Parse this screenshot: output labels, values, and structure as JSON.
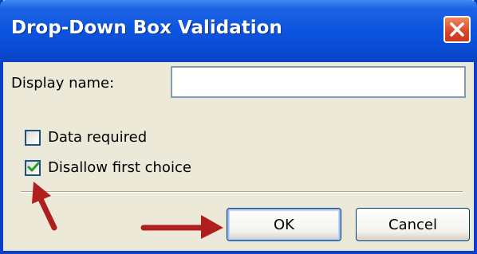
{
  "dialog": {
    "title": "Drop-Down Box Validation",
    "close_icon": "close-icon",
    "display_name": {
      "label": "Display name:",
      "value": ""
    },
    "checkboxes": [
      {
        "label": "Data required",
        "checked": false
      },
      {
        "label": "Disallow first choice",
        "checked": true
      }
    ],
    "buttons": {
      "ok": "OK",
      "cancel": "Cancel"
    },
    "annotations": [
      {
        "icon": "red-arrow-icon",
        "points_to": "disallow-first-choice-checkbox"
      },
      {
        "icon": "red-arrow-icon",
        "points_to": "ok-button"
      }
    ]
  },
  "colors": {
    "title_bar": "#0a4bd3",
    "dialog_face": "#ece9d8",
    "close_button": "#d8452a",
    "annotation_arrow": "#b01e1e",
    "checkmark": "#21a121"
  }
}
